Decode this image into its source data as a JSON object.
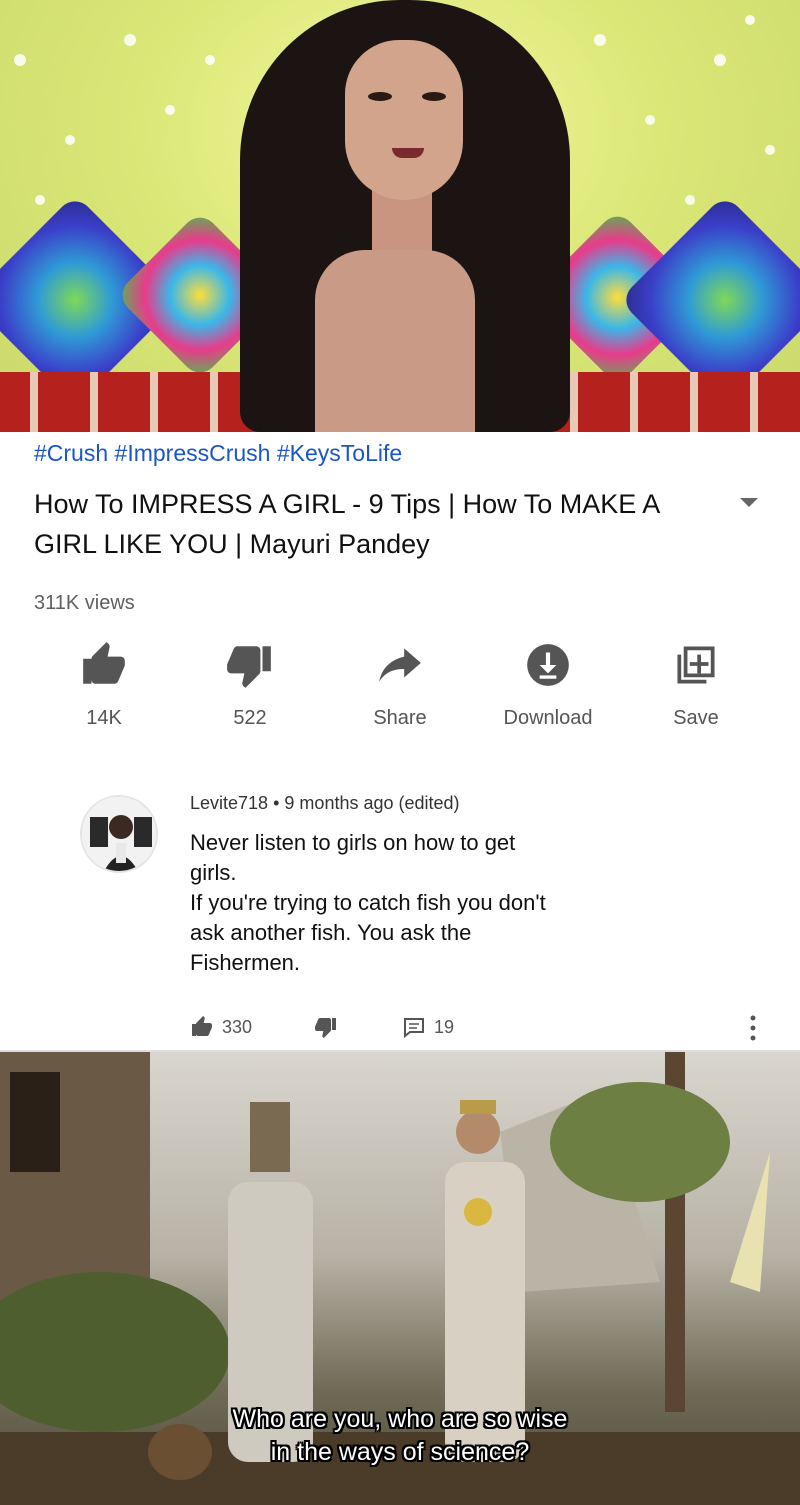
{
  "video": {
    "hashtags": "#Crush #ImpressCrush #KeysToLife",
    "title": "How To IMPRESS A GIRL - 9 Tips | How To MAKE A GIRL LIKE YOU | Mayuri Pandey",
    "views": "311K views"
  },
  "actions": [
    {
      "label": "14K",
      "icon": "thumbs-up-icon"
    },
    {
      "label": "522",
      "icon": "thumbs-down-icon"
    },
    {
      "label": "Share",
      "icon": "share-icon"
    },
    {
      "label": "Download",
      "icon": "download-icon"
    },
    {
      "label": "Save",
      "icon": "add-to-playlist-icon"
    }
  ],
  "comment": {
    "author": "Levite718",
    "separator": "•",
    "time": "9 months ago (edited)",
    "lines": [
      "Never listen to girls on how to get",
      "girls.",
      "If you're trying to catch fish you don't",
      "ask another fish. You ask the",
      "Fishermen."
    ],
    "likes": "330",
    "replies": "19"
  },
  "movie": {
    "subtitle_lines": [
      "Who are you, who are so wise",
      "in the ways of science?"
    ]
  },
  "colors": {
    "hashtag": "#1a56c9",
    "icon": "#555555"
  }
}
